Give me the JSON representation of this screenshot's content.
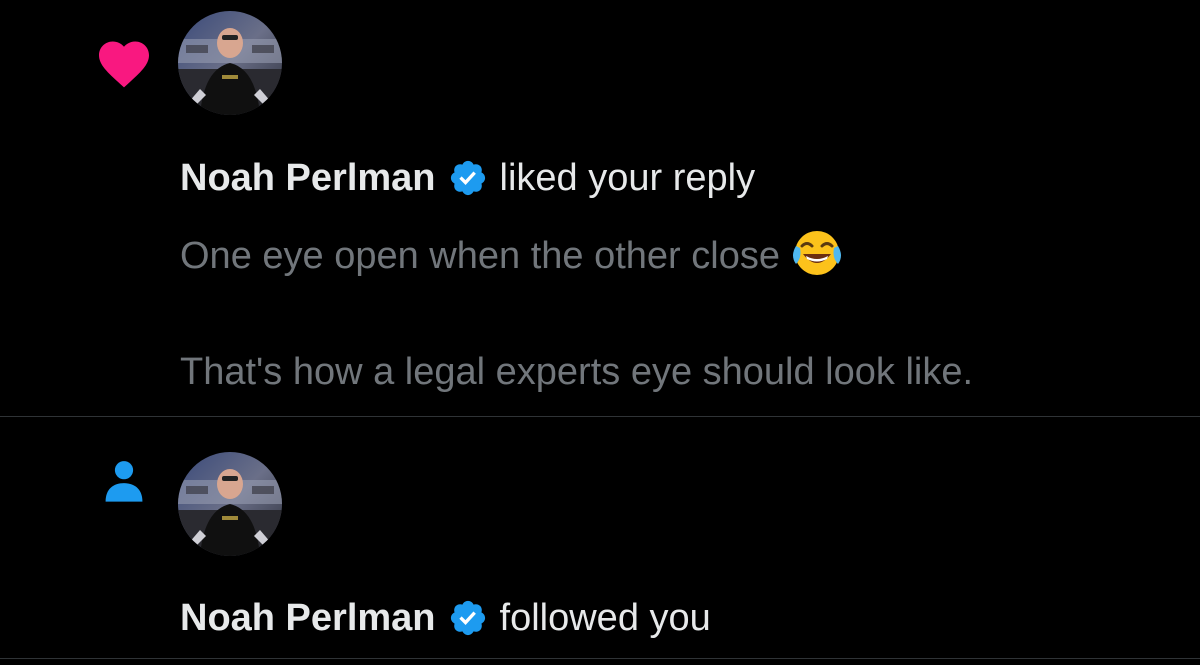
{
  "colors": {
    "background": "#000000",
    "divider": "#2f3336",
    "primary_text": "#e7e9ea",
    "secondary_text": "#71767b",
    "like_pink": "#f91880",
    "follow_blue": "#1d9bf0",
    "verified_blue": "#1d9bf0"
  },
  "notifications": [
    {
      "type": "like",
      "type_icon": "heart-icon",
      "user_name": "Noah Perlman",
      "verified_icon": "verified-badge-icon",
      "action": "liked your reply",
      "preview_line_1": "One eye open when the other close",
      "preview_emoji": "face-with-tears-of-joy",
      "preview_line_2": "That's how a legal experts eye should look like."
    },
    {
      "type": "follow",
      "type_icon": "person-icon",
      "user_name": "Noah Perlman",
      "verified_icon": "verified-badge-icon",
      "action": "followed you"
    }
  ]
}
